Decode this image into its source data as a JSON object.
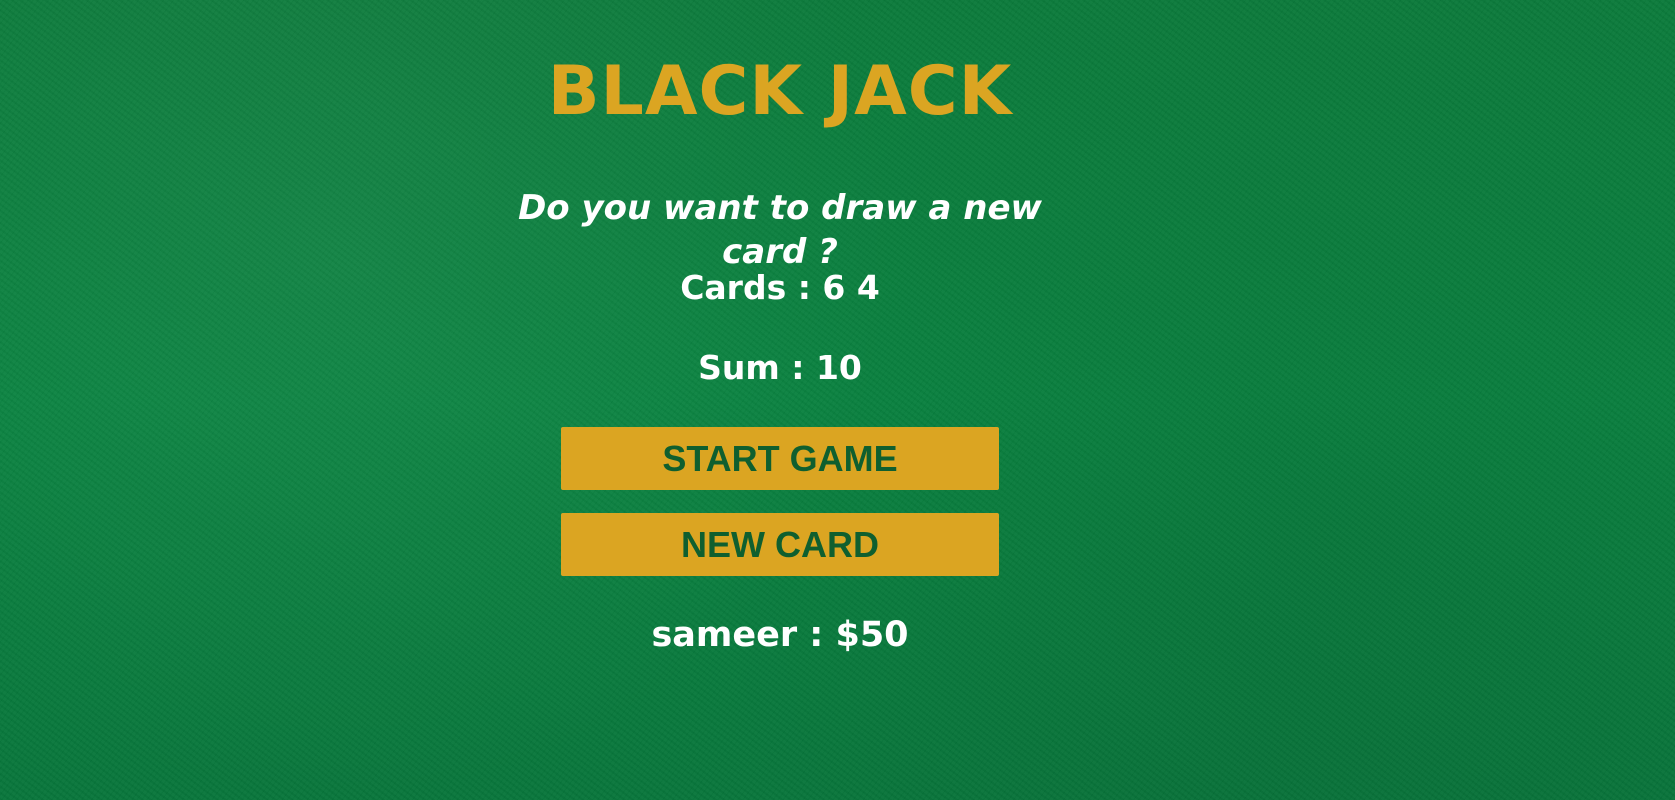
{
  "game": {
    "title": "BLACK JACK",
    "message": "Do you want to draw a new card ?",
    "cards_text": "Cards : 6 4",
    "sum_text": "Sum : 10",
    "player_text": "sameer : $50"
  },
  "buttons": {
    "start_label": "START GAME",
    "new_card_label": "NEW CARD"
  },
  "colors": {
    "table_green": "#0a7a3c",
    "accent_gold": "#dba522",
    "button_text": "#0f5f2f",
    "text_white": "#ffffff"
  }
}
